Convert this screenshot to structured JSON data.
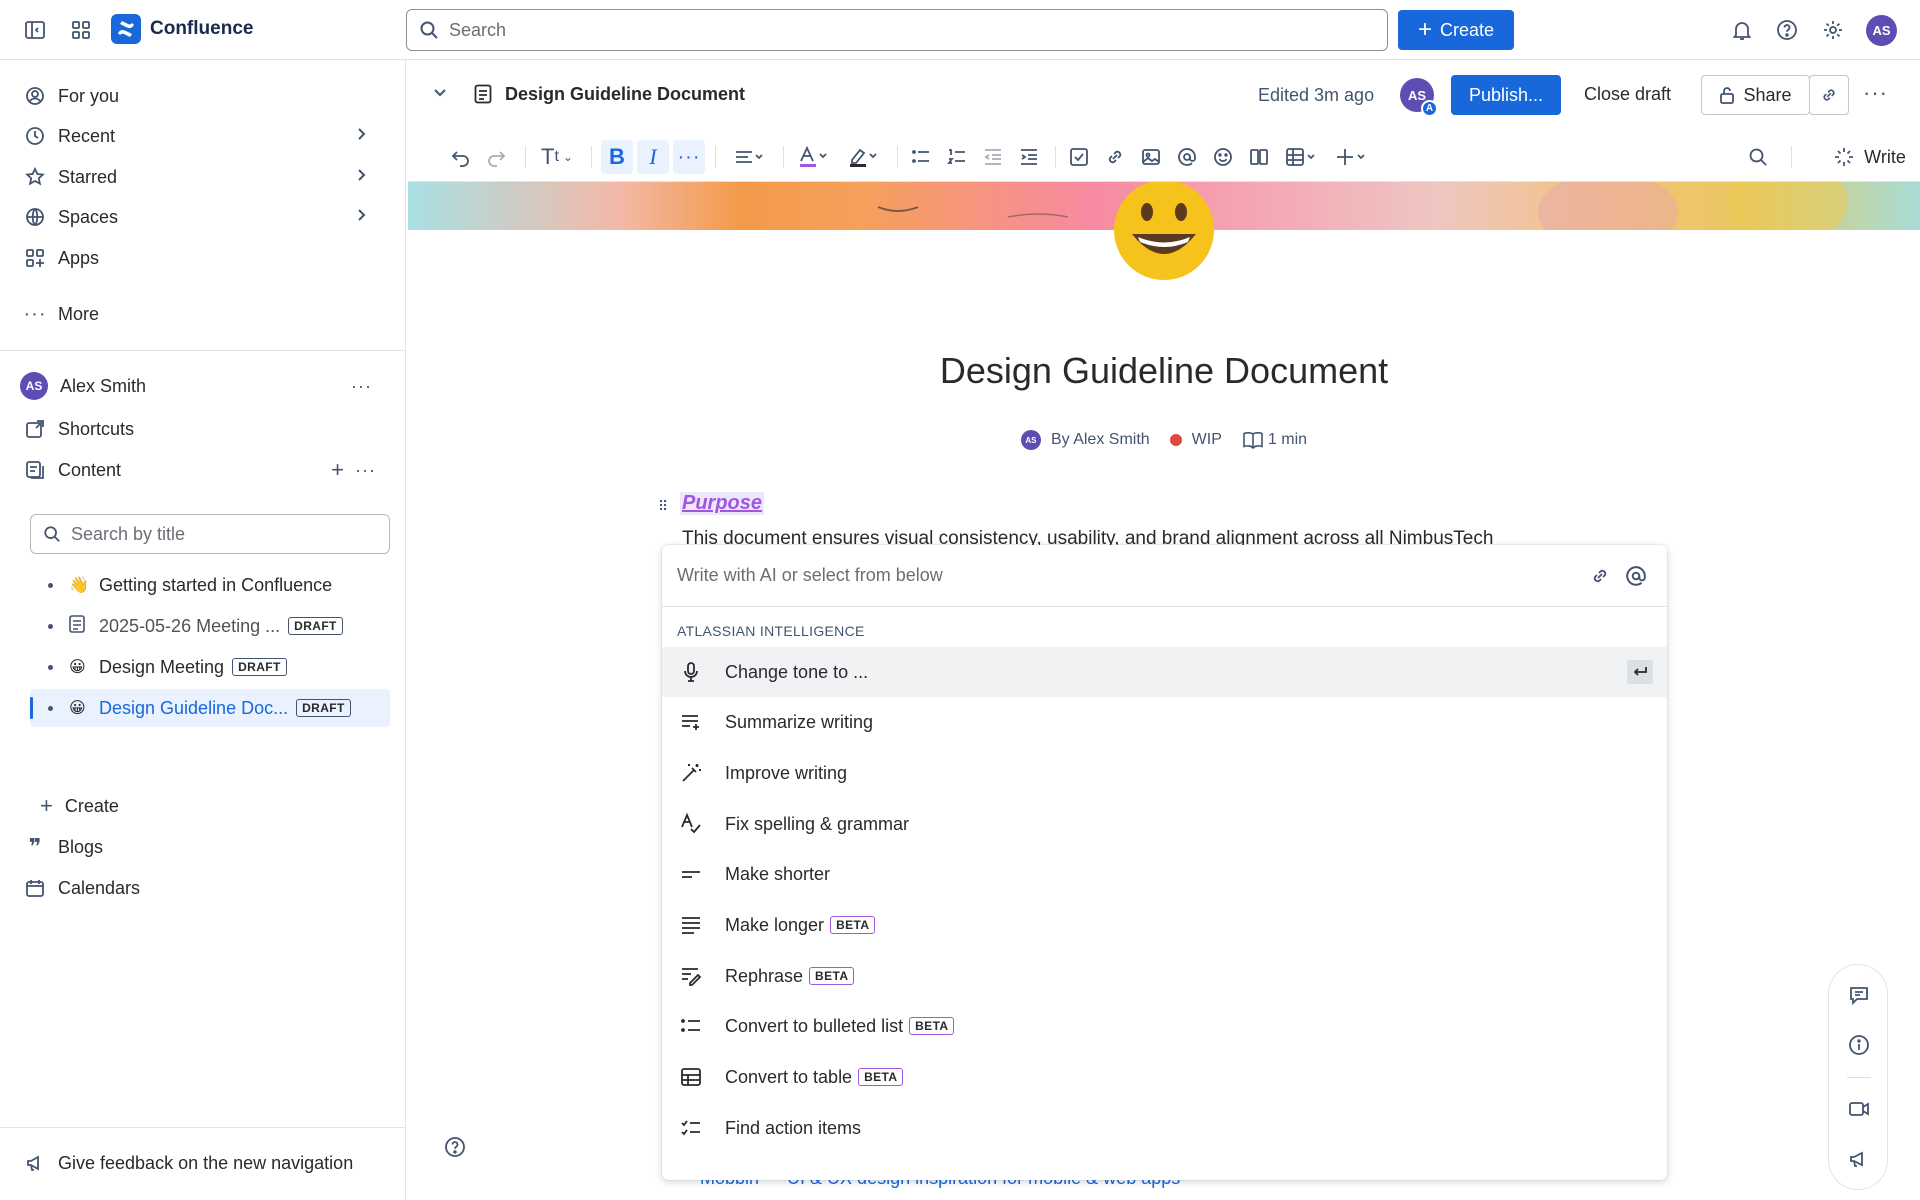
{
  "app": {
    "name": "Confluence",
    "user_initials": "AS"
  },
  "search": {
    "placeholder": "Search"
  },
  "create_label": "Create",
  "sidebar": {
    "nav": [
      {
        "label": "For you",
        "icon": "user-circle-icon",
        "chevron": false
      },
      {
        "label": "Recent",
        "icon": "clock-icon",
        "chevron": true
      },
      {
        "label": "Starred",
        "icon": "star-icon",
        "chevron": true
      },
      {
        "label": "Spaces",
        "icon": "globe-icon",
        "chevron": true
      },
      {
        "label": "Apps",
        "icon": "apps-icon",
        "chevron": false
      }
    ],
    "more_label": "More",
    "space_owner": "Alex Smith",
    "shortcuts_label": "Shortcuts",
    "content_label": "Content",
    "search_placeholder": "Search by title",
    "tree": [
      {
        "label": "Getting started in Confluence",
        "emoji": "👋",
        "draft": false
      },
      {
        "label": "2025-05-26 Meeting ...",
        "emoji": "",
        "draft": true,
        "muted": true
      },
      {
        "label": "Design Meeting",
        "emoji": "😀",
        "draft": true
      },
      {
        "label": "Design Guideline Doc...",
        "emoji": "😀",
        "draft": true,
        "active": true
      }
    ],
    "draft_label": "DRAFT",
    "create_label": "Create",
    "blogs_label": "Blogs",
    "calendars_label": "Calendars",
    "feedback_label": "Give feedback on the new navigation"
  },
  "page": {
    "breadcrumb_title": "Design Guideline Document",
    "edited": "Edited 3m ago",
    "collab_initials": "AS",
    "collab_badge": "A",
    "publish_label": "Publish...",
    "close_draft_label": "Close draft",
    "share_label": "Share",
    "write_label": "Write",
    "title": "Design Guideline Document",
    "byline_initials": "AS",
    "byline_author": "By Alex Smith",
    "status": "WIP",
    "read_time": "1 min",
    "heading": "Purpose",
    "body": "This document ensures visual consistency, usability, and brand alignment across all NimbusTech",
    "bottom_link": "Mobbin — UI & UX design inspiration for mobile & web apps"
  },
  "ai": {
    "placeholder": "Write with AI or select from below",
    "section": "ATLASSIAN INTELLIGENCE",
    "beta_label": "BETA",
    "items": [
      {
        "label": "Change tone to ...",
        "icon": "microphone-icon",
        "beta": false,
        "selected": true
      },
      {
        "label": "Summarize writing",
        "icon": "summarize-icon",
        "beta": false
      },
      {
        "label": "Improve writing",
        "icon": "magic-wand-icon",
        "beta": false
      },
      {
        "label": "Fix spelling & grammar",
        "icon": "spellcheck-icon",
        "beta": false
      },
      {
        "label": "Make shorter",
        "icon": "shorten-icon",
        "beta": false
      },
      {
        "label": "Make longer",
        "icon": "lengthen-icon",
        "beta": true
      },
      {
        "label": "Rephrase",
        "icon": "rephrase-icon",
        "beta": true
      },
      {
        "label": "Convert to bulleted list",
        "icon": "bulleted-list-icon",
        "beta": true
      },
      {
        "label": "Convert to table",
        "icon": "table-icon",
        "beta": true
      },
      {
        "label": "Find action items",
        "icon": "checklist-icon",
        "beta": false
      }
    ]
  },
  "colors": {
    "primary": "#1868db",
    "ai_purple": "#9f56e0",
    "avatar": "#5e4db2",
    "status_red": "#e2483d"
  }
}
